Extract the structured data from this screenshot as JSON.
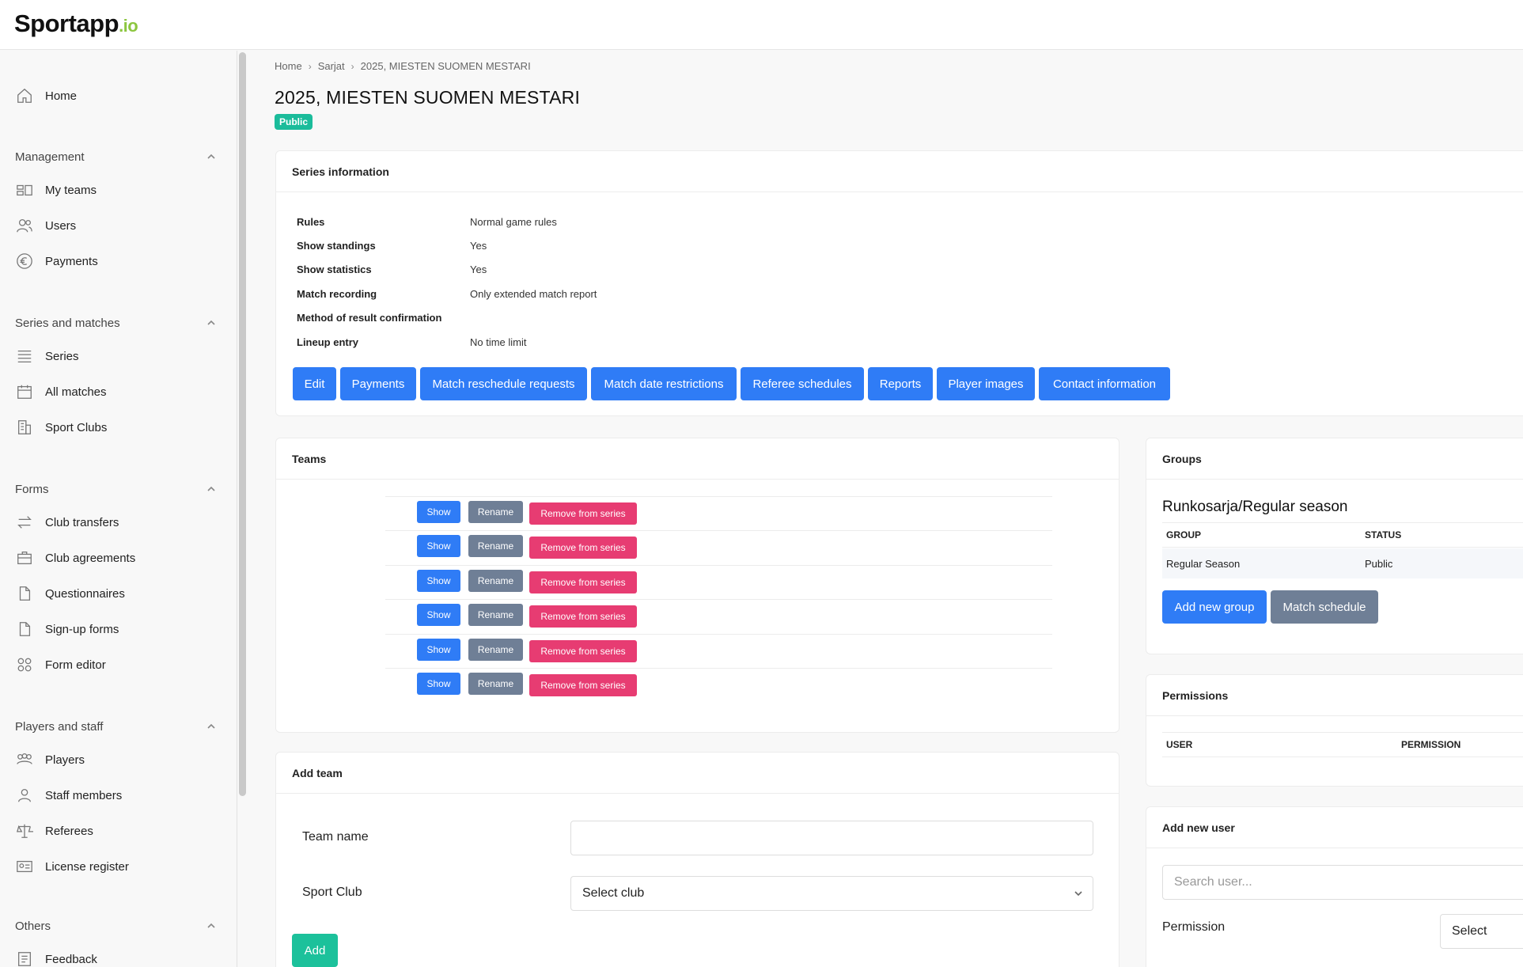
{
  "app": {
    "logo_main": "Sportapp",
    "logo_suffix": ".io"
  },
  "sidebar": {
    "home": "Home",
    "sections": [
      {
        "title": "Management",
        "items": [
          "My teams",
          "Users",
          "Payments"
        ]
      },
      {
        "title": "Series and matches",
        "items": [
          "Series",
          "All matches",
          "Sport Clubs"
        ]
      },
      {
        "title": "Forms",
        "items": [
          "Club transfers",
          "Club agreements",
          "Questionnaires",
          "Sign-up forms",
          "Form editor"
        ]
      },
      {
        "title": "Players and staff",
        "items": [
          "Players",
          "Staff members",
          "Referees",
          "License register"
        ]
      },
      {
        "title": "Others",
        "items": [
          "Feedback"
        ]
      }
    ]
  },
  "breadcrumb": [
    "Home",
    "Sarjat",
    "2025, MIESTEN SUOMEN MESTARI"
  ],
  "page": {
    "title": "2025, MIESTEN SUOMEN MESTARI",
    "visibility": "Public"
  },
  "series_info": {
    "title": "Series information",
    "rows": [
      {
        "key": "Rules",
        "value": "Normal game rules"
      },
      {
        "key": "Show standings",
        "value": "Yes"
      },
      {
        "key": "Show statistics",
        "value": "Yes"
      },
      {
        "key": "Match recording",
        "value": "Only extended match report"
      },
      {
        "key": "Method of result confirmation",
        "value": ""
      },
      {
        "key": "Lineup entry",
        "value": "No time limit"
      }
    ],
    "actions": [
      "Edit",
      "Payments",
      "Match reschedule requests",
      "Match date restrictions",
      "Referee schedules",
      "Reports",
      "Player images",
      "Contact information"
    ]
  },
  "teams": {
    "title": "Teams",
    "row_actions": {
      "show": "Show",
      "rename": "Rename",
      "remove": "Remove from series"
    },
    "count": 6
  },
  "add_team": {
    "title": "Add team",
    "team_name_label": "Team name",
    "team_name_value": "",
    "club_label": "Sport Club",
    "club_value": "Select club",
    "submit": "Add"
  },
  "groups": {
    "title": "Groups",
    "subtitle": "Runkosarja/Regular season",
    "columns": [
      "GROUP",
      "STATUS"
    ],
    "rows": [
      {
        "group": "Regular Season",
        "status": "Public"
      }
    ],
    "add_button": "Add new group",
    "schedule_button": "Match schedule"
  },
  "permissions": {
    "title": "Permissions",
    "columns": [
      "USER",
      "PERMISSION"
    ]
  },
  "add_user": {
    "title": "Add new user",
    "search_placeholder": "Search user...",
    "permission_label": "Permission",
    "permission_value": "Select"
  },
  "colors": {
    "primary": "#2f7cf6",
    "secondary": "#6f7f96",
    "danger": "#e73c72",
    "success": "#1cc19b",
    "accent": "#8cc63f"
  }
}
